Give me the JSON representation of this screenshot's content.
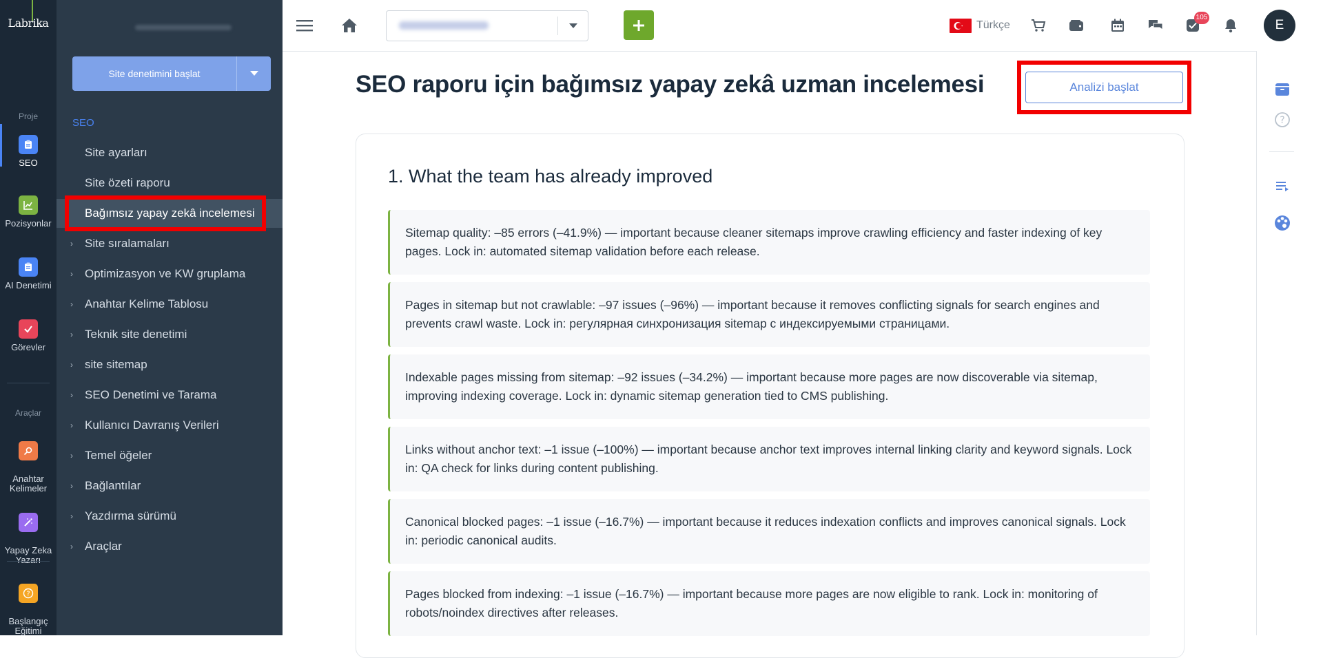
{
  "app": {
    "logo": "Labrika"
  },
  "rail": {
    "project_caption": "Proje",
    "tools_caption": "Araçlar",
    "items": [
      {
        "label": "SEO",
        "icon": "clipboard-icon",
        "color": "#4a84f5"
      },
      {
        "label": "Pozisyonlar",
        "icon": "chart-icon",
        "color": "#7cb342"
      },
      {
        "label": "AI Denetimi",
        "icon": "clipboard-icon",
        "color": "#4a84f5"
      },
      {
        "label": "Görevler",
        "icon": "checkbox-icon",
        "color": "#e8455a"
      },
      {
        "label": "Anahtar\nKelimeler",
        "icon": "key-search-icon",
        "color": "#f07a47"
      },
      {
        "label": "Yapay Zeka\nYazarı",
        "icon": "magic-wand-icon",
        "color": "#9a6cf0"
      },
      {
        "label": "Başlangıç\nEğitimi",
        "icon": "question-icon",
        "color": "#f5a524"
      }
    ]
  },
  "subnav": {
    "start_button": "Site denetimini başlat",
    "section_title": "SEO",
    "items": [
      {
        "label": "Site ayarları",
        "has_children": false
      },
      {
        "label": "Site özeti raporu",
        "has_children": false
      },
      {
        "label": "Bağımsız yapay zekâ incelemesi",
        "has_children": false,
        "active": true
      },
      {
        "label": "Site sıralamaları",
        "has_children": true
      },
      {
        "label": "Optimizasyon ve KW gruplama",
        "has_children": true
      },
      {
        "label": "Anahtar Kelime Tablosu",
        "has_children": true
      },
      {
        "label": "Teknik site denetimi",
        "has_children": true
      },
      {
        "label": "site sitemap",
        "has_children": true
      },
      {
        "label": "SEO Denetimi ve Tarama",
        "has_children": true
      },
      {
        "label": "Kullanıcı Davranış Verileri",
        "has_children": true
      },
      {
        "label": "Temel öğeler",
        "has_children": true
      },
      {
        "label": "Bağlantılar",
        "has_children": true
      },
      {
        "label": "Yazdırma sürümü",
        "has_children": true
      },
      {
        "label": "Araçlar",
        "has_children": true
      }
    ]
  },
  "topbar": {
    "language": "Türkçe",
    "notification_count": "105",
    "avatar_initial": "E"
  },
  "main": {
    "title": "SEO raporu için bağımsız yapay zekâ uzman incelemesi",
    "analyze_button": "Analizi başlat",
    "section_title": "1. What the team has already improved",
    "items": [
      "Sitemap quality: –85 errors (–41.9%) — important because cleaner sitemaps improve crawling efficiency and faster indexing of key pages. Lock in: automated sitemap validation before each release.",
      "Pages in sitemap but not crawlable: –97 issues (–96%) — important because it removes conflicting signals for search engines and prevents crawl waste. Lock in: регулярная синхронизация sitemap с индексируемыми страницами.",
      "Indexable pages missing from sitemap: –92 issues (–34.2%) — important because more pages are now discoverable via sitemap, improving indexing coverage. Lock in: dynamic sitemap generation tied to CMS publishing.",
      "Links without anchor text: –1 issue (–100%) — important because anchor text improves internal linking clarity and keyword signals. Lock in: QA check for links during content publishing.",
      "Canonical blocked pages: –1 issue (–16.7%) — important because it reduces indexation conflicts and improves canonical signals. Lock in: periodic canonical audits.",
      "Pages blocked from indexing: –1 issue (–16.7%) — important because more pages are now eligible to rank. Lock in: monitoring of robots/noindex directives after releases."
    ]
  },
  "colors": {
    "accent": "#4a84f5",
    "green": "#7cb342",
    "highlight": "#f20000",
    "sidebar": "#2b3a49",
    "rail": "#1b2836"
  }
}
